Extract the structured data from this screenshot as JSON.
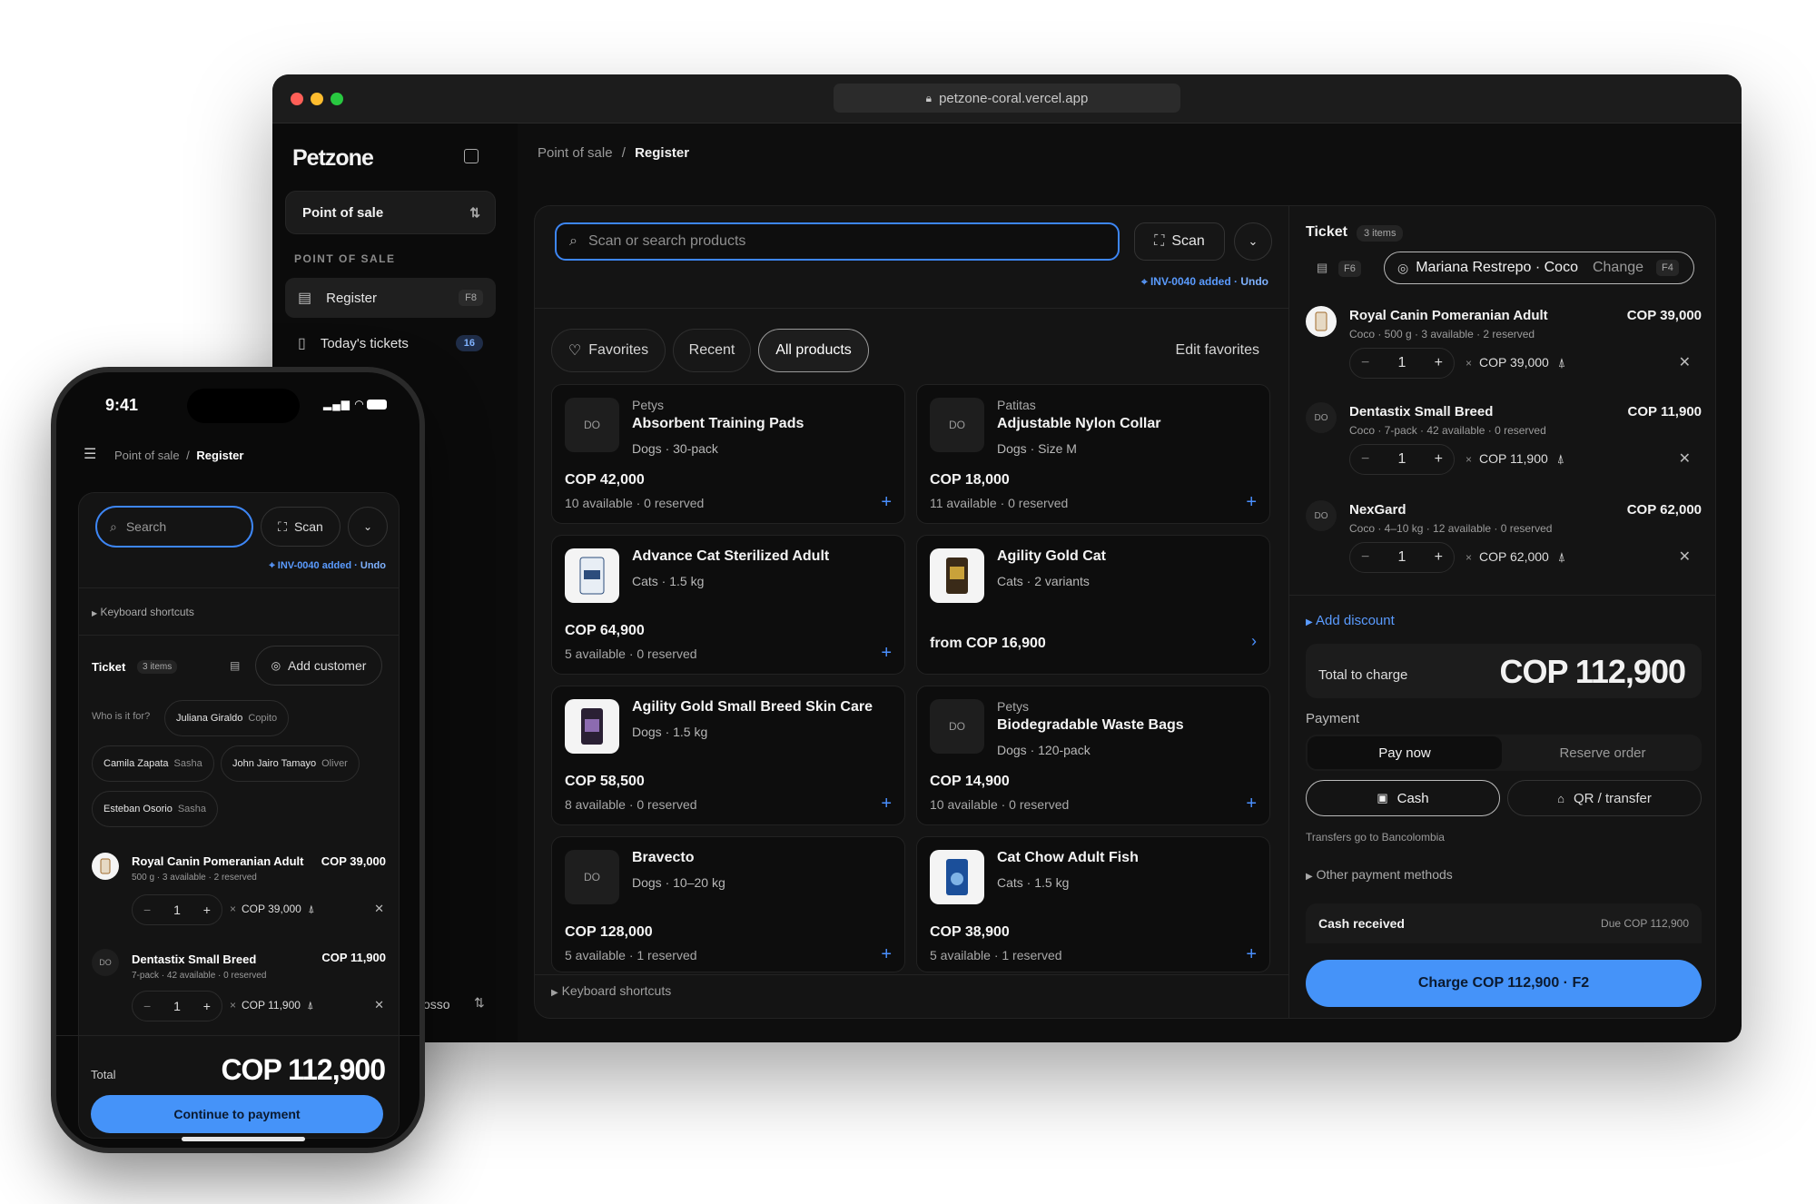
{
  "browser": {
    "url": "petzone-coral.vercel.app"
  },
  "sidebar": {
    "brand": "Petzone",
    "mode_select": "Point of sale",
    "section": "POINT OF SALE",
    "items": [
      {
        "label": "Register",
        "shortcut": "F8"
      },
      {
        "label": "Today's tickets",
        "count": "16"
      }
    ]
  },
  "breadcrumb": {
    "parent": "Point of sale",
    "sep": "/",
    "current": "Register"
  },
  "search": {
    "placeholder": "Scan or search products",
    "scan_label": "Scan",
    "notice": "INV-0040 added · ",
    "undo": "Undo"
  },
  "tabs": [
    "Favorites",
    "Recent",
    "All products"
  ],
  "edit_favorites": "Edit favorites",
  "products": [
    {
      "brand": "Petys",
      "name": "Absorbent Training Pads",
      "meta": "Dogs · 30-pack",
      "price": "COP 42,000",
      "avail": "10 available · 0 reserved",
      "thumb": "DO"
    },
    {
      "brand": "Patitas",
      "name": "Adjustable Nylon Collar",
      "meta": "Dogs · Size M",
      "price": "COP 18,000",
      "avail": "11 available · 0 reserved",
      "thumb": "DO"
    },
    {
      "brand": "",
      "name": "Advance Cat Sterilized Adult",
      "meta": "Cats · 1.5 kg",
      "price": "COP 64,900",
      "avail": "5 available · 0 reserved",
      "thumb": ""
    },
    {
      "brand": "",
      "name": "Agility Gold Cat",
      "meta": "Cats · 2 variants",
      "price": "from COP 16,900",
      "avail": "",
      "thumb": ""
    },
    {
      "brand": "",
      "name": "Agility Gold Small Breed Skin Care",
      "meta": "Dogs · 1.5 kg",
      "price": "COP 58,500",
      "avail": "8 available · 0 reserved",
      "thumb": ""
    },
    {
      "brand": "Petys",
      "name": "Biodegradable Waste Bags",
      "meta": "Dogs · 120-pack",
      "price": "COP 14,900",
      "avail": "10 available · 0 reserved",
      "thumb": "DO"
    },
    {
      "brand": "",
      "name": "Bravecto",
      "meta": "Dogs · 10–20 kg",
      "price": "COP 128,000",
      "avail": "5 available · 1 reserved",
      "thumb": "DO"
    },
    {
      "brand": "",
      "name": "Cat Chow Adult Fish",
      "meta": "Cats · 1.5 kg",
      "price": "COP 38,900",
      "avail": "5 available · 1 reserved",
      "thumb": ""
    }
  ],
  "keyboard_shortcuts": "Keyboard shortcuts",
  "ticket": {
    "title": "Ticket",
    "count": "3 items",
    "shortcut_f6": "F6",
    "customer": "Mariana Restrepo · Coco",
    "change": "Change",
    "shortcut_f4": "F4",
    "items": [
      {
        "name": "Royal Canin Pomeranian Adult",
        "meta": "Coco · 500 g · 3 available · 2 reserved",
        "total": "COP 39,000",
        "qty": "1",
        "unit": "COP 39,000",
        "thumb": ""
      },
      {
        "name": "Dentastix Small Breed",
        "meta": "Coco · 7-pack · 42 available · 0 reserved",
        "total": "COP 11,900",
        "qty": "1",
        "unit": "COP 11,900",
        "thumb": "DO"
      },
      {
        "name": "NexGard",
        "meta": "Coco · 4–10 kg · 12 available · 0 reserved",
        "total": "COP 62,000",
        "qty": "1",
        "unit": "COP 62,000",
        "thumb": "DO"
      }
    ],
    "add_discount": "Add discount",
    "total_label": "Total to charge",
    "total": "COP 112,900",
    "payment_label": "Payment",
    "pay_now": "Pay now",
    "reserve": "Reserve order",
    "cash": "Cash",
    "qr": "QR / transfer",
    "transfers_note": "Transfers go to Bancolombia",
    "other_methods": "Other payment methods",
    "cash_received": "Cash received",
    "due": "Due COP 112,900",
    "charge": "Charge COP 112,900 · F2"
  },
  "phone": {
    "time": "9:41",
    "search_placeholder": "Search",
    "scan": "Scan",
    "notice": "INV-0040 added · ",
    "undo": "Undo",
    "keyboard_shortcuts": "Keyboard shortcuts",
    "ticket": "Ticket",
    "count": "3 items",
    "add_customer": "Add customer",
    "who": "Who is it for?",
    "customers": [
      {
        "name": "Juliana Giraldo",
        "pet": "Copito"
      },
      {
        "name": "Camila Zapata",
        "pet": "Sasha"
      },
      {
        "name": "John Jairo Tamayo",
        "pet": "Oliver"
      },
      {
        "name": "Esteban Osorio",
        "pet": "Sasha"
      }
    ],
    "items": [
      {
        "name": "Royal Canin Pomeranian Adult",
        "meta": "500 g · 3 available · 2 reserved",
        "total": "COP 39,000",
        "qty": "1",
        "unit": "COP 39,000"
      },
      {
        "name": "Dentastix Small Breed",
        "meta": "7-pack · 42 available · 0 reserved",
        "total": "COP 11,900",
        "qty": "1",
        "unit": "COP 11,900"
      }
    ],
    "total_label": "Total",
    "total": "COP 112,900",
    "continue": "Continue to payment"
  },
  "behind_fragment": "osso"
}
